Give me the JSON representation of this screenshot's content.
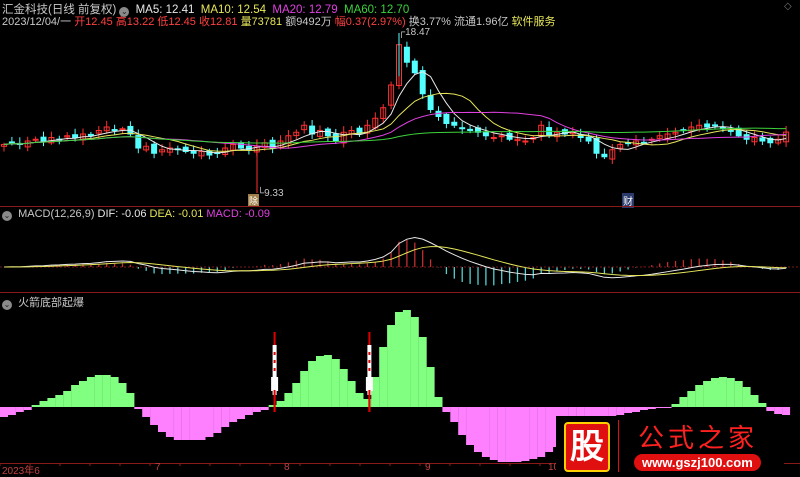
{
  "header": {
    "stock_title": "汇金科技(日线 前复权)",
    "ma5": "MA5: 12.41",
    "ma10": "MA10: 12.54",
    "ma20": "MA20: 12.79",
    "ma60": "MA60: 12.70",
    "date": "2023/12/04/一",
    "open": "开12.45",
    "high": "高13.22",
    "low": "低12.45",
    "close": "收12.81",
    "volume": "量73781",
    "amount": "额9492万",
    "change": "幅0.37(2.97%)",
    "turnover": "换3.77%",
    "float": "流通1.96亿",
    "sector": "软件服务"
  },
  "main_chart": {
    "high_label": "18.47",
    "low_label": "9.33",
    "marker_left": "除",
    "marker_right": "财",
    "closes": [
      12.1,
      12.2,
      12.1,
      12.3,
      12.4,
      12.3,
      12.5,
      12.4,
      12.6,
      12.5,
      12.7,
      12.6,
      12.9,
      13.1,
      12.9,
      13.0,
      12.7,
      11.9,
      12.0,
      11.6,
      11.8,
      11.9,
      11.8,
      11.7,
      11.6,
      11.7,
      11.5,
      11.6,
      11.9,
      12.1,
      11.9,
      11.8,
      12.0,
      12.2,
      11.9,
      12.3,
      12.6,
      12.8,
      13.2,
      12.7,
      12.9,
      12.6,
      12.3,
      12.8,
      12.9,
      12.7,
      13.2,
      13.6,
      14.2,
      15.5,
      17.8,
      16.8,
      16.2,
      15.0,
      14.1,
      13.7,
      13.3,
      13.2,
      13.0,
      12.9,
      12.8,
      12.6,
      12.5,
      12.6,
      12.4,
      12.4,
      12.3,
      12.5,
      13.2,
      12.6,
      12.8,
      12.7,
      12.8,
      12.5,
      12.3,
      11.6,
      11.4,
      11.8,
      12.1,
      12.2,
      12.3,
      12.2,
      12.4,
      12.6,
      12.7,
      12.8,
      12.9,
      13.1,
      13.2,
      13.1,
      13.2,
      13.0,
      12.9,
      12.6,
      12.4,
      12.5,
      12.3,
      12.2,
      12.4,
      12.81
    ],
    "colors": {
      "up": "#ff3030",
      "down": "#54ffff",
      "ma5": "#e8e8e8",
      "ma10": "#e6e65a",
      "ma20": "#e040e0",
      "ma60": "#3cd23c"
    }
  },
  "macd": {
    "title": "MACD(12,26,9)",
    "dif": "DIF: -0.06",
    "dea": "DEA: -0.01",
    "macd": "MACD: -0.09"
  },
  "indicator": {
    "title": "火箭底部起爆",
    "values": [
      -10,
      -8,
      -5,
      -3,
      2,
      6,
      9,
      12,
      16,
      22,
      26,
      30,
      32,
      32,
      30,
      24,
      14,
      -2,
      -10,
      -18,
      -25,
      -30,
      -33,
      -33,
      -33,
      -33,
      -30,
      -26,
      -20,
      -15,
      -12,
      -8,
      -5,
      -3,
      2,
      6,
      14,
      24,
      36,
      46,
      51,
      52,
      48,
      38,
      26,
      14,
      8,
      30,
      60,
      82,
      95,
      97,
      90,
      70,
      40,
      10,
      -5,
      -15,
      -28,
      -38,
      -45,
      -50,
      -53,
      -55,
      -55,
      -55,
      -54,
      -52,
      -50,
      -45,
      -40,
      -34,
      -28,
      -22,
      -18,
      -14,
      -12,
      -10,
      -8,
      -6,
      -5,
      -3,
      -2,
      -1,
      -1,
      3,
      10,
      16,
      22,
      26,
      29,
      30,
      29,
      26,
      20,
      12,
      4,
      -4,
      -7,
      -8
    ],
    "rocket_indices": [
      34,
      46
    ],
    "colors": {
      "positive": "#80ff80",
      "negative": "#ff80ff"
    }
  },
  "x_axis": [
    "2023年6",
    "7",
    "8",
    "9",
    "10"
  ],
  "watermark": {
    "badge": "股",
    "name": "公式之家",
    "url": "www.gszj100.com"
  }
}
